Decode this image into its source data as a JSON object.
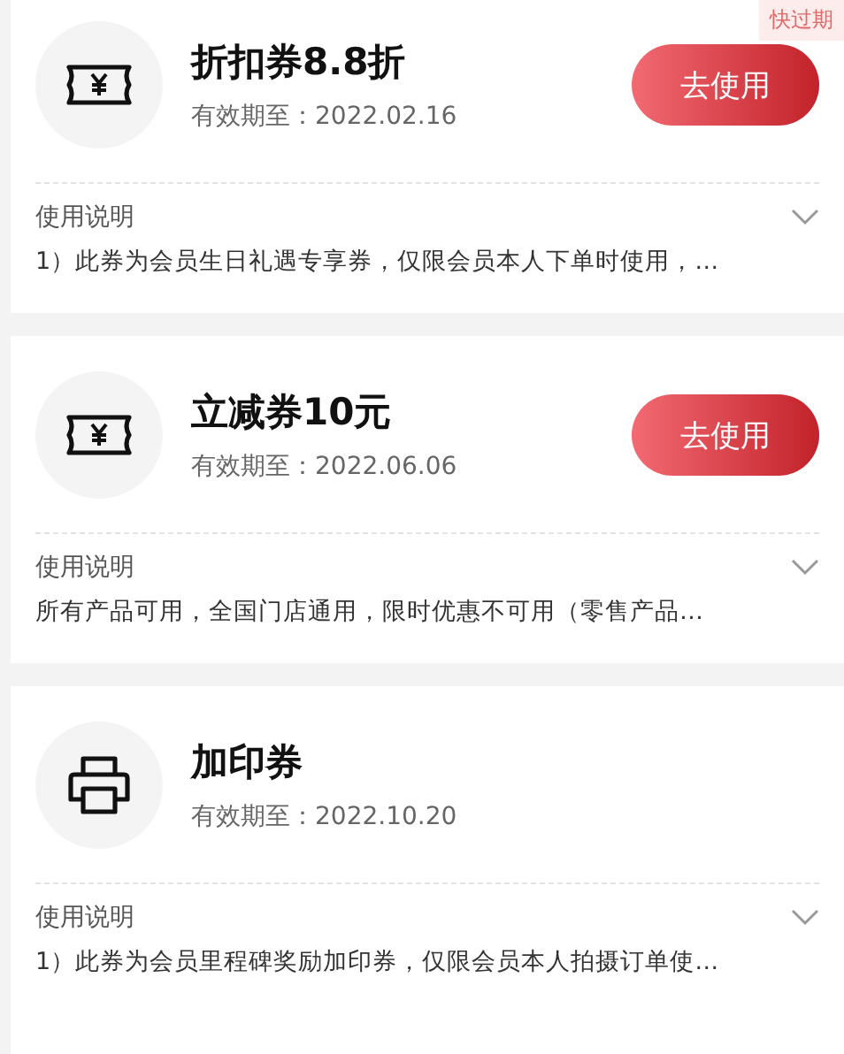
{
  "coupons": [
    {
      "kind": "ticket",
      "badge": "快过期",
      "title": "折扣券8.8折",
      "validity": "有效期至：2022.02.16",
      "button": "去使用",
      "notes_label": "使用说明",
      "notes": "1）此券为会员生日礼遇专享券，仅限会员本人下单时使用，…",
      "expanded": false
    },
    {
      "kind": "ticket",
      "title": "立减券10元",
      "validity": "有效期至：2022.06.06",
      "button": "去使用",
      "notes_label": "使用说明",
      "notes": "所有产品可用，全国门店通用，限时优惠不可用（零售产品…",
      "expanded": false
    },
    {
      "kind": "printer",
      "title": "加印券",
      "validity": "有效期至：2022.10.20",
      "notes_label": "使用说明",
      "notes": "1）此券为会员里程碑奖励加印券，仅限会员本人拍摄订单使…",
      "expanded": false
    }
  ]
}
